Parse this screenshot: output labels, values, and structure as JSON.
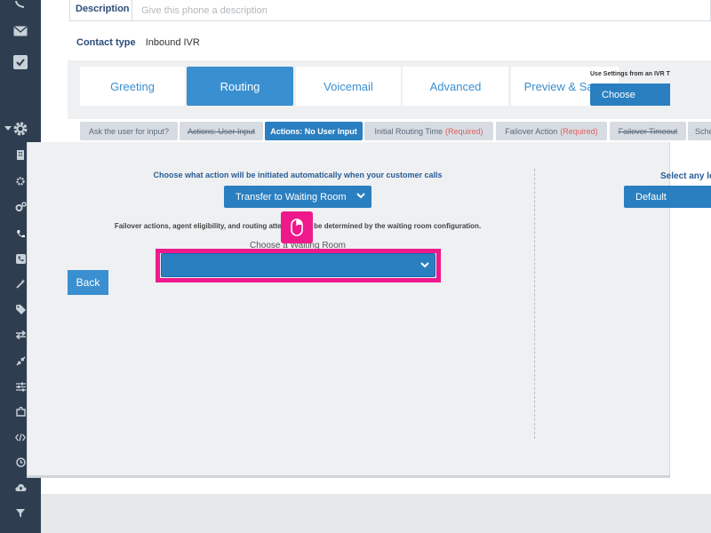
{
  "description": {
    "label": "Description",
    "placeholder": "Give this phone a description",
    "value": ""
  },
  "contact_type": {
    "label": "Contact type",
    "value": "Inbound IVR"
  },
  "tabs": [
    {
      "label": "Greeting",
      "active": false
    },
    {
      "label": "Routing",
      "active": true
    },
    {
      "label": "Voicemail",
      "active": false
    },
    {
      "label": "Advanced",
      "active": false
    },
    {
      "label": "Preview & Save",
      "active": false
    }
  ],
  "ivr_settings": {
    "label": "Use Settings from an IVR T",
    "button": "Choose"
  },
  "subtabs": [
    {
      "label": "Ask the user for input?",
      "active": false
    },
    {
      "label": "Actions: User Input",
      "active": false,
      "strikethrough": true
    },
    {
      "label": "Actions: No User Input",
      "active": true
    },
    {
      "label": "Initial Routing Time",
      "required": "(Required)",
      "active": false
    },
    {
      "label": "Failover Action",
      "required": "(Required)",
      "active": false
    },
    {
      "label": "Failover Timeout",
      "active": false,
      "strikethrough": true
    },
    {
      "label": "Sche",
      "active": false
    }
  ],
  "routing": {
    "choose_action_text": "Choose what action will be initiated automatically when your customer calls",
    "action_selected": "Transfer to Waiting Room",
    "failover_text": "Failover actions, agent eligibility, and routing attempts will be determined by the waiting room configuration.",
    "waiting_room_label": "Choose a Waiting Room",
    "waiting_room_selected": "",
    "back_button": "Back",
    "select_any_label": "Select any le",
    "default_selected": "Default"
  },
  "colors": {
    "sidebar": "#2e3e50",
    "accent": "#3a8fd0",
    "select_blue": "#2a7fc0",
    "highlight": "#ee1a8c",
    "required": "#e06060"
  }
}
